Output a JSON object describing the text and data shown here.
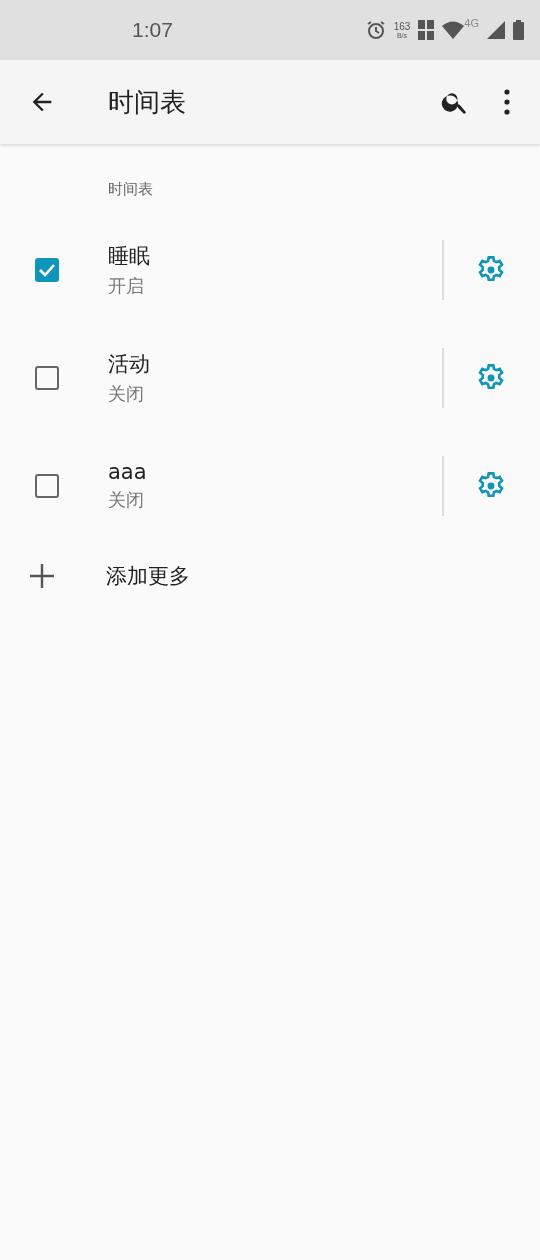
{
  "status_bar": {
    "time": "1:07",
    "speed": "163",
    "speed_unit": "B/s",
    "network": "4G"
  },
  "app_bar": {
    "title": "时间表"
  },
  "section_header": "时间表",
  "schedules": [
    {
      "name": "睡眠",
      "status": "开启",
      "checked": true
    },
    {
      "name": "活动",
      "status": "关闭",
      "checked": false
    },
    {
      "name": "aaa",
      "status": "关闭",
      "checked": false
    }
  ],
  "add_more": "添加更多"
}
